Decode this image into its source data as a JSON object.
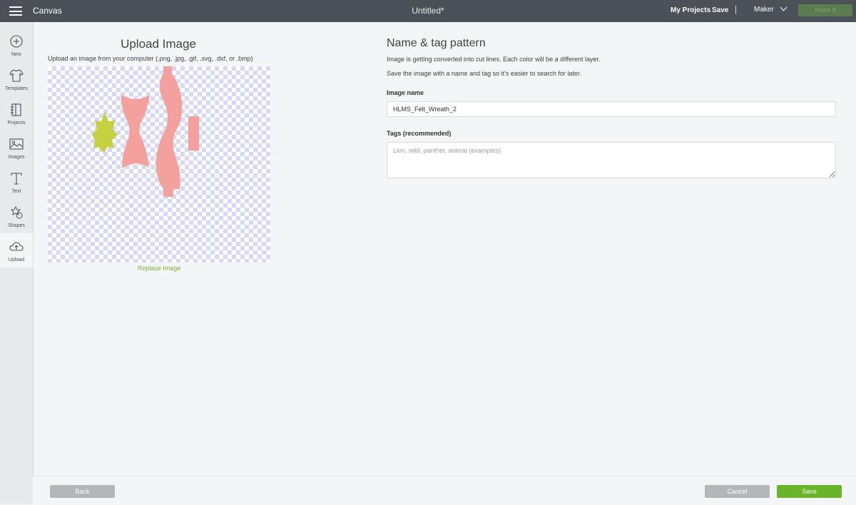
{
  "topbar": {
    "menu_icon": "hamburger-icon",
    "app_title": "Canvas",
    "doc_title": "Untitled*",
    "my_projects": "My Projects",
    "save": "Save",
    "separator": "|",
    "machine": "Maker",
    "machine_icon": "chevron-down-icon",
    "make_it": "Make It"
  },
  "sidebar": {
    "items": [
      {
        "label": "New",
        "icon": "plus-circle-icon"
      },
      {
        "label": "Templates",
        "icon": "tshirt-icon"
      },
      {
        "label": "Projects",
        "icon": "notebook-icon"
      },
      {
        "label": "Images",
        "icon": "image-icon"
      },
      {
        "label": "Text",
        "icon": "text-t-icon"
      },
      {
        "label": "Shapes",
        "icon": "shapes-icon"
      },
      {
        "label": "Upload",
        "icon": "cloud-upload-icon"
      }
    ],
    "active": "Upload"
  },
  "upload": {
    "title": "Upload Image",
    "subtitle": "Upload an image from your computer (.png, .jpg, .gif, .svg, .dxf, or .bmp)",
    "replace_link": "Replace Image",
    "colors": {
      "pink": "#f4a09d",
      "green": "#c6d142",
      "checker": "#d7d8f7"
    }
  },
  "form": {
    "title": "Name & tag pattern",
    "line1": "Image is getting converted into cut lines. Each color will be a different layer.",
    "line2": "Save the image with a name and tag so it's easier to search for later.",
    "image_name_label": "Image name",
    "image_name_value": "HLMS_Felt_Wreath_2",
    "tags_label": "Tags (recommended)",
    "tags_placeholder": "Lion, wild, panther, animal (examples)"
  },
  "footer": {
    "back": "Back",
    "cancel": "Cancel",
    "save": "Save"
  },
  "colors": {
    "topbar": "#4b5157",
    "accent_green": "#6ab429",
    "link_green": "#7ab33c",
    "disabled_gray": "#b4b6b8"
  }
}
